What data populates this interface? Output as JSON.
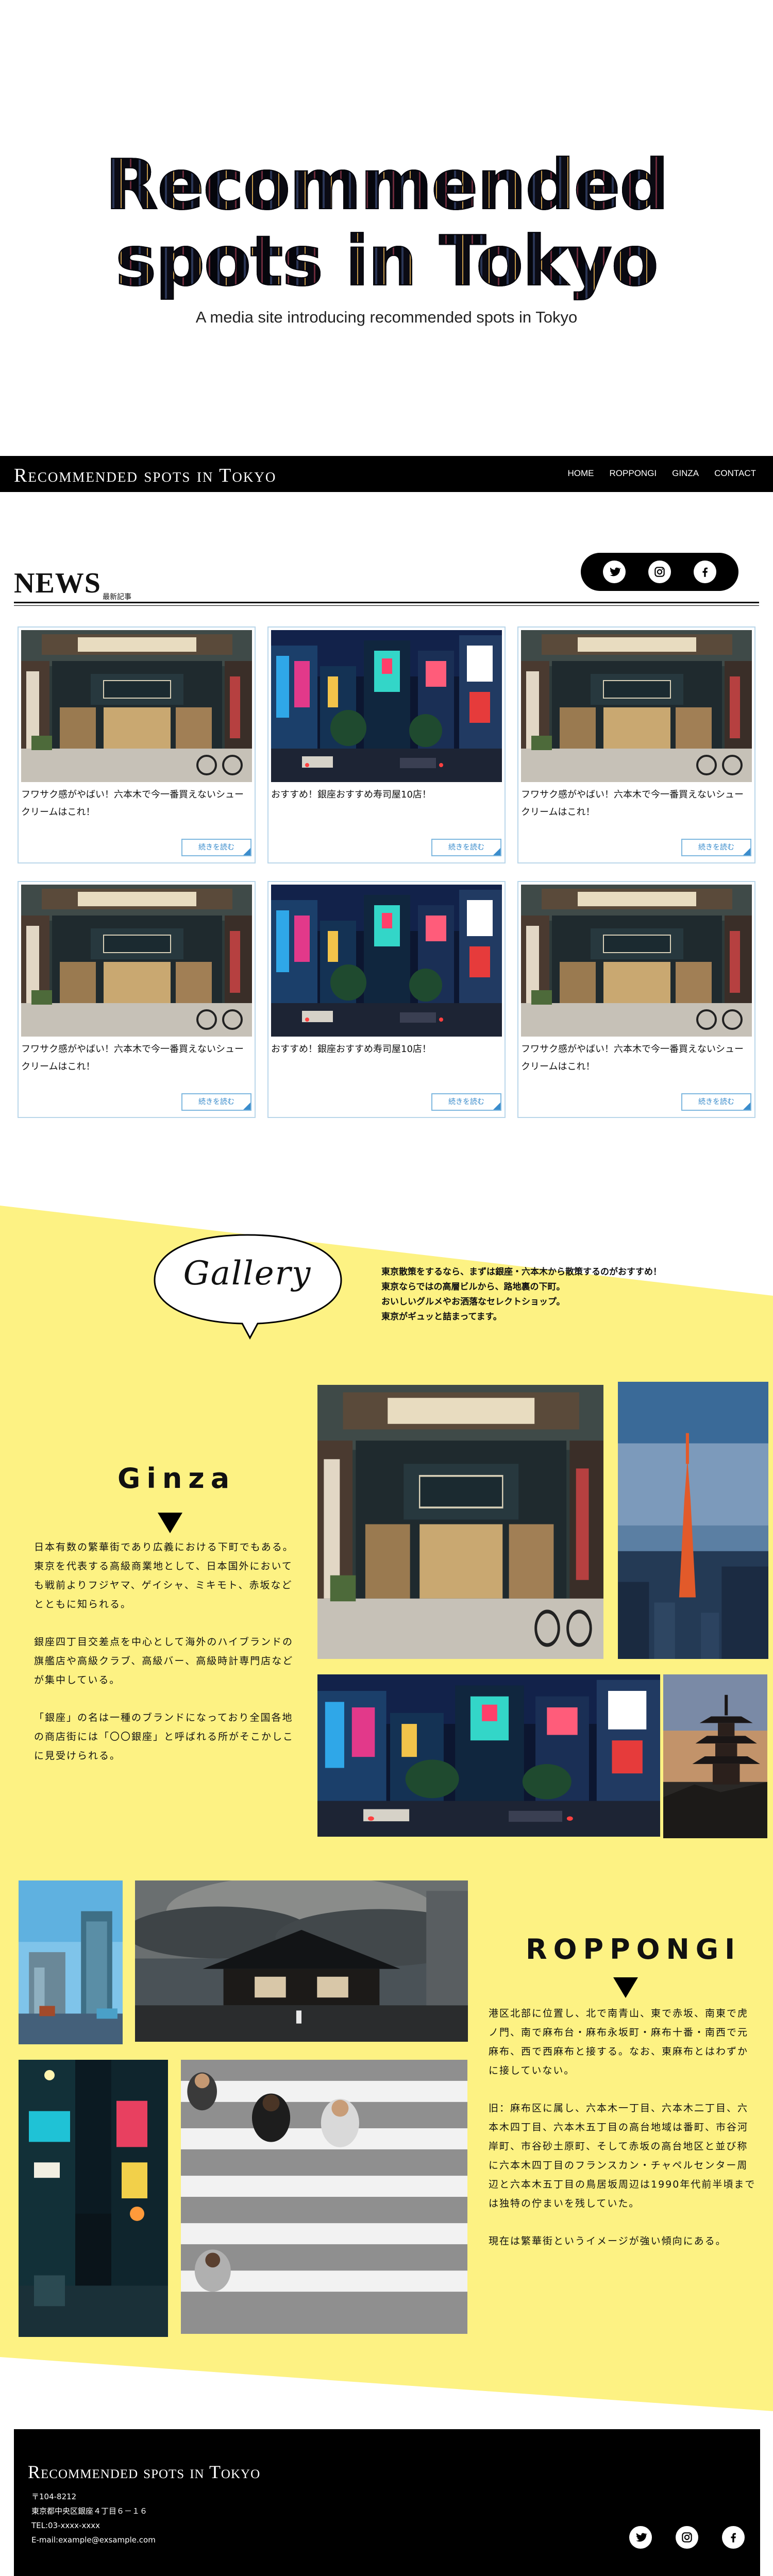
{
  "hero": {
    "title_line1": "Recommended",
    "title_line2": "spots in Tokyo",
    "subtitle": "A media site introducing recommended spots in Tokyo"
  },
  "nav": {
    "brand": "Recommended spots in Tokyo",
    "links": [
      "HOME",
      "ROPPONGI",
      "GINZA",
      "CONTACT"
    ]
  },
  "news": {
    "title": "NEWS",
    "subtitle": "最新記事",
    "social_icons": [
      "twitter-icon",
      "instagram-icon",
      "facebook-icon"
    ],
    "cards": [
      {
        "image": "shop-front",
        "text": "フワサク感がやばい！六本木で今一番買えないシュークリームはこれ！",
        "more": "続きを読む"
      },
      {
        "image": "city-street-night",
        "text": "おすすめ！銀座おすすめ寿司屋10店！",
        "more": "続きを読む"
      },
      {
        "image": "shop-front",
        "text": "フワサク感がやばい！六本木で今一番買えないシュークリームはこれ！",
        "more": "続きを読む"
      },
      {
        "image": "shop-front",
        "text": "フワサク感がやばい！六本木で今一番買えないシュークリームはこれ！",
        "more": "続きを読む"
      },
      {
        "image": "city-street-night",
        "text": "おすすめ！銀座おすすめ寿司屋10店！",
        "more": "続きを読む"
      },
      {
        "image": "shop-front",
        "text": "フワサク感がやばい！六本木で今一番買えないシュークリームはこれ！",
        "more": "続きを読む"
      }
    ]
  },
  "gallery": {
    "title": "Gallery",
    "text_lines": [
      "東京散策をするなら、まずは銀座・六本木から散策するのがおすすめ！",
      "東京ならではの高層ビルから、路地裏の下町。",
      "おいしいグルメやお洒落なセレクトショップ。",
      "東京がギュッと詰まってます。"
    ]
  },
  "ginza": {
    "title": "Ginza",
    "paragraphs": [
      "日本有数の繁華街であり広義における下町でもある。東京を代表する高級商業地として、日本国外においても戦前よりフジヤマ、ゲイシャ、ミキモト、赤坂などとともに知られる。",
      "銀座四丁目交差点を中心として海外のハイブランドの旗艦店や高級クラブ、高級バー、高級時計専門店などが集中している。",
      "「銀座」の名は一種のブランドになっており全国各地の商店街には「〇〇銀座」と呼ばれる所がそこかしこに見受けられる。"
    ]
  },
  "roppongi": {
    "title": "ROPPONGI",
    "paragraphs": [
      "港区北部に位置し、北で南青山、東で赤坂、南東で虎ノ門、南で麻布台・麻布永坂町・麻布十番・南西で元麻布、西で西麻布と接する。なお、東麻布とはわずかに接していない。",
      "旧：麻布区に属し、六本木一丁目、六本木二丁目、六本木四丁目、六本木五丁目の高台地域は番町、市谷河岸町、市谷砂土原町、そして赤坂の高台地区と並び称に六本木四丁目のフランスカン・チャペルセンター周辺と六本木五丁目の鳥居坂周辺は1990年代前半頃までは独特の佇まいを残していた。",
      "現在は繁華街というイメージが強い傾向にある。"
    ]
  },
  "footer": {
    "brand": "Recommended spots in Tokyo",
    "zip": "〒104-8212",
    "address": "東京都中央区銀座４丁目６－１６",
    "tel": "TEL:03-xxxx-xxxx",
    "email": "E-mail:example@exsample.com",
    "social_icons": [
      "twitter-icon",
      "instagram-icon",
      "facebook-icon"
    ]
  },
  "colors": {
    "accent_yellow": "#fdf283",
    "nav_black": "#000000",
    "link_blue": "#3a8ccc",
    "card_border": "#b9d6ea"
  }
}
